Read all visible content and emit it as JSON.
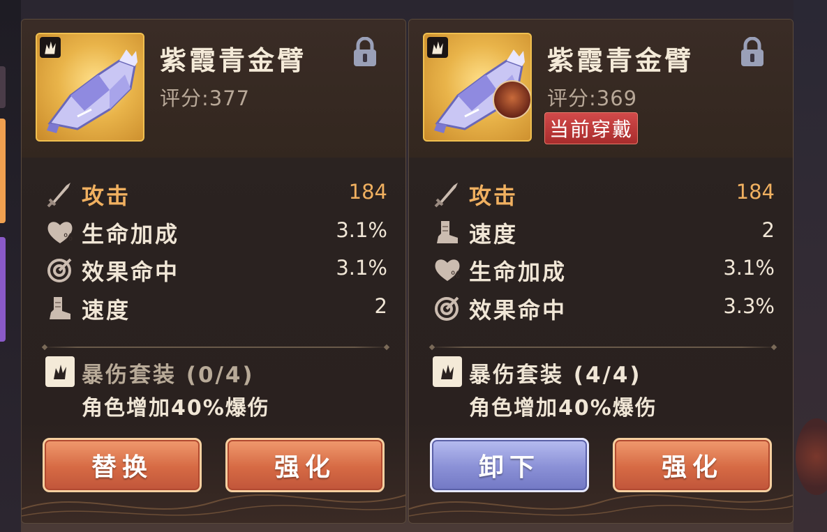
{
  "left_panel": {
    "item_name": "紫霞青金臂",
    "score": "评分:377",
    "stats": [
      {
        "icon": "sword-icon",
        "label": "攻击",
        "value": "184",
        "main": true
      },
      {
        "icon": "heart-percent-icon",
        "label": "生命加成",
        "value": "3.1%"
      },
      {
        "icon": "target-icon",
        "label": "效果命中",
        "value": "3.1%"
      },
      {
        "icon": "boot-icon",
        "label": "速度",
        "value": "2"
      }
    ],
    "set_title": "暴伤套装 (0/4)",
    "set_desc": "角色增加40%爆伤",
    "buttons": {
      "left": "替换",
      "right": "强化"
    }
  },
  "right_panel": {
    "item_name": "紫霞青金臂",
    "score": "评分:369",
    "equipped_badge": "当前穿戴",
    "stats": [
      {
        "icon": "sword-icon",
        "label": "攻击",
        "value": "184",
        "main": true
      },
      {
        "icon": "boot-icon",
        "label": "速度",
        "value": "2"
      },
      {
        "icon": "heart-percent-icon",
        "label": "生命加成",
        "value": "3.1%"
      },
      {
        "icon": "target-icon",
        "label": "效果命中",
        "value": "3.3%"
      }
    ],
    "set_title": "暴伤套装 (4/4)",
    "set_desc": "角色增加40%爆伤",
    "buttons": {
      "left": "卸下",
      "right": "强化"
    }
  },
  "colors": {
    "main_stat": "#f0b060",
    "set_inactive": "#b8aa98",
    "set_active": "#f0e6d6",
    "button_orange": "#d66a44",
    "button_blue": "#8a90d6"
  }
}
